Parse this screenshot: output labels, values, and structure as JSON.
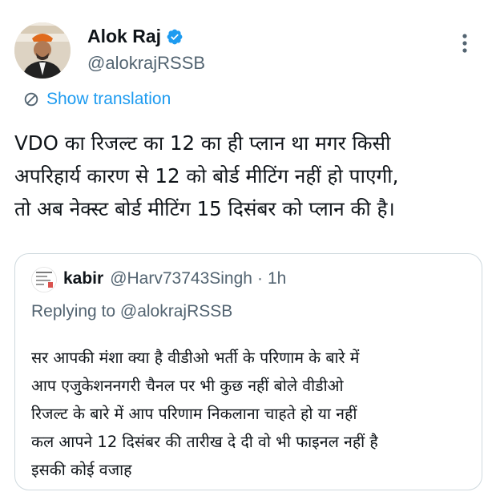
{
  "author": {
    "name": "Alok Raj",
    "handle": "@alokrajRSSB",
    "verified": true,
    "avatar": "profile-photo"
  },
  "translate_label": "Show translation",
  "tweet_text": "VDO का रिजल्ट का 12 का ही प्लान था मगर किसी\nअपरिहार्य कारण से 12 को बोर्ड मीटिंग नहीं हो पाएगी,\nतो अब  नेक्स्ट बोर्ड मीटिंग 15 दिसंबर को प्लान की है।",
  "quoted": {
    "name": "kabir",
    "handle": "@Harv73743Singh",
    "separator": "·",
    "time": "1h",
    "replying_to": "Replying to @alokrajRSSB",
    "text": "सर आपकी मंशा क्या है वीडीओ भर्ती के परिणाम के बारे में\nआप   एजुकेशननगरी चैनल पर भी कुछ नहीं बोले वीडीओ\nरिजल्ट के बारे में आप परिणाम निकलाना चाहते हो या नहीं\nकल आपने 12 दिसंबर की तारीख दे दी वो भी फाइनल नहीं है\nइसकी कोई वजाह"
  },
  "colors": {
    "accent": "#1d9bf0",
    "text_primary": "#0f1419",
    "text_secondary": "#536471",
    "border": "#cfd9de"
  },
  "icons": [
    "verified-badge-icon",
    "more-options-icon",
    "translate-icon"
  ]
}
